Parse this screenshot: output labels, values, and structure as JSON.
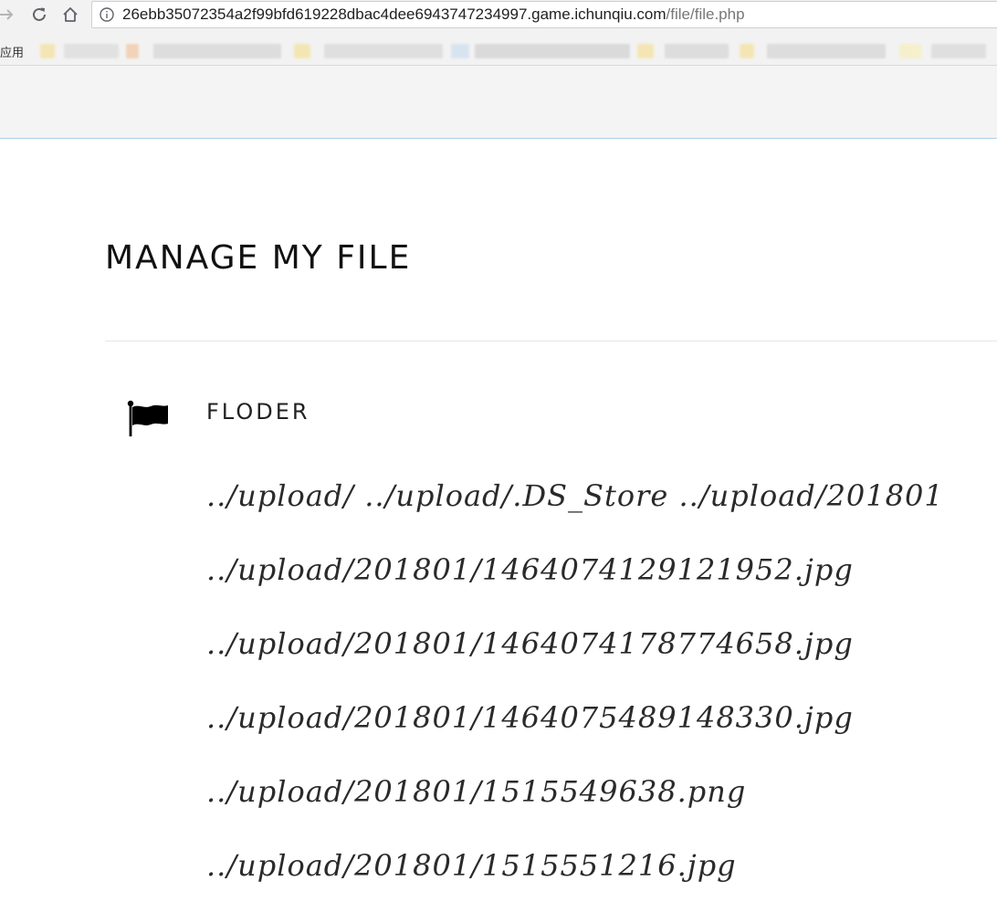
{
  "browser": {
    "url_host": "26ebb35072354a2f99bfd619228dbac4dee6943747234997.game.ichunqiu.com",
    "url_path": "/file/file.php",
    "bookmarks_apps_label": "应用"
  },
  "page": {
    "title": "MANAGE MY FILE",
    "folder_heading": "FLODER",
    "files": [
      "../upload/  ../upload/.DS_Store  ../upload/201801",
      "../upload/201801/1464074129121952.jpg",
      "../upload/201801/1464074178774658.jpg",
      "../upload/201801/1464075489148330.jpg",
      "../upload/201801/1515549638.png",
      "../upload/201801/1515551216.jpg"
    ]
  },
  "icons": {
    "back": "arrow-right-icon",
    "reload": "reload-icon",
    "home": "home-icon",
    "info": "info-icon",
    "flag": "flag-icon"
  },
  "colors": {
    "chrome_bg": "#f2f2f2",
    "header_bg": "#f4f4f4",
    "header_border": "#aed0ea",
    "text": "#111111"
  }
}
